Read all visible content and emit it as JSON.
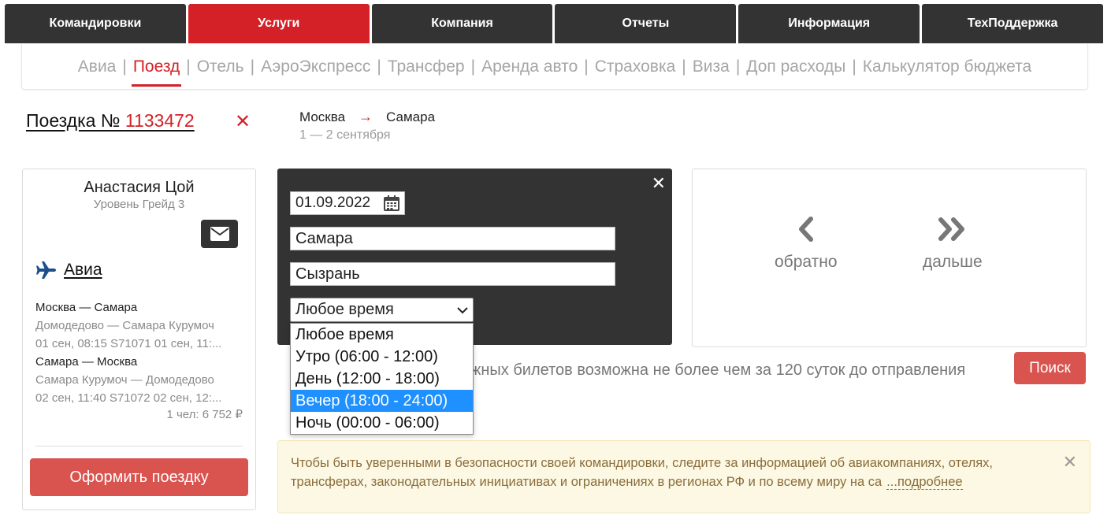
{
  "topnav": [
    "Командировки",
    "Услуги",
    "Компания",
    "Отчеты",
    "Информация",
    "ТехПоддержка"
  ],
  "topnav_active": "Услуги",
  "subnav": [
    "Авиа",
    "Поезд",
    "Отель",
    "АэроЭкспресс",
    "Трансфер",
    "Аренда авто",
    "Страховка",
    "Виза",
    "Доп расходы",
    "Калькулятор бюджета"
  ],
  "subnav_active": "Поезд",
  "trip": {
    "label": "Поездка № ",
    "number": "1133472",
    "close": "✕",
    "from": "Москва",
    "arrow": "→",
    "to": "Самара",
    "dates": "1 — 2 сентября"
  },
  "traveler": {
    "name": "Анастасия Цой",
    "level": "Уровень Грейд 3",
    "service_title": "Авиа",
    "seg1_route": "Москва — Самара",
    "seg1_airports": "Домодедово — Самара Курумоч",
    "seg1_details": "01 сен, 08:15 S71071 01 сен, 11:...",
    "seg2_route": "Самара — Москва",
    "seg2_airports": "Самара Курумоч — Домодедово",
    "seg2_details": "02 сен, 11:40 S71072 02 сен, 12:...",
    "price": "1 чел: 6 752 ₽",
    "order_button": "Оформить поездку"
  },
  "search": {
    "date": "01.09.2022",
    "from": "Самара",
    "to": "Сызрань",
    "time_selected": "Любое время",
    "time_options": [
      "Любое время",
      "Утро (06:00 - 12:00)",
      "День (12:00 - 18:00)",
      "Вечер (18:00 - 24:00)",
      "Ночь (00:00 - 06:00)"
    ],
    "time_highlighted": "Вечер (18:00 - 24:00)",
    "close": "✕"
  },
  "nav": {
    "back_label": "обратно",
    "next_label": "дальше"
  },
  "notice": "жных билетов возможна не более чем за 120 суток до отправления",
  "search_button": "Поиск",
  "alert": {
    "text": "Чтобы быть уверенными в безопасности своей командировки, следите за информацией об авиакомпаниях, отелях, трансферах, законодательных инициативах и ограничениях в регионах РФ и по всему миру на са",
    "more": "...подробнее",
    "close": "✕"
  },
  "colors": {
    "accent": "#d42027",
    "dark": "#333333",
    "button": "#d9534f",
    "highlight": "#1e90ff",
    "alert_bg": "#fcf8e3"
  }
}
